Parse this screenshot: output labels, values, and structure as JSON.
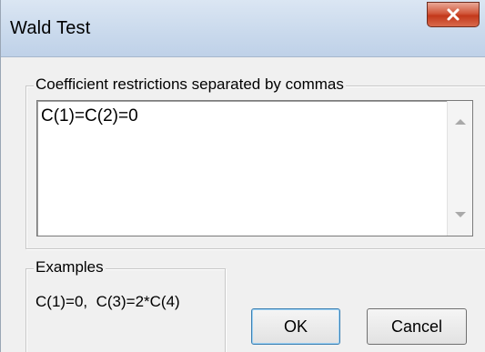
{
  "window": {
    "title": "Wald Test",
    "close_glyph": "X"
  },
  "restrictions": {
    "group_label": "Coefficient restrictions separated by commas",
    "value": "C(1)=C(2)=0"
  },
  "examples": {
    "group_label": "Examples",
    "text": "C(1)=0,  C(3)=2*C(4)"
  },
  "buttons": {
    "ok_label": "OK",
    "cancel_label": "Cancel"
  },
  "colors": {
    "close_button": "#c94a2e",
    "ok_focus_border": "#3c7fb1"
  },
  "icons": {
    "close": "close-icon",
    "scroll_up": "scroll-up-arrow-icon",
    "scroll_down": "scroll-down-arrow-icon"
  }
}
